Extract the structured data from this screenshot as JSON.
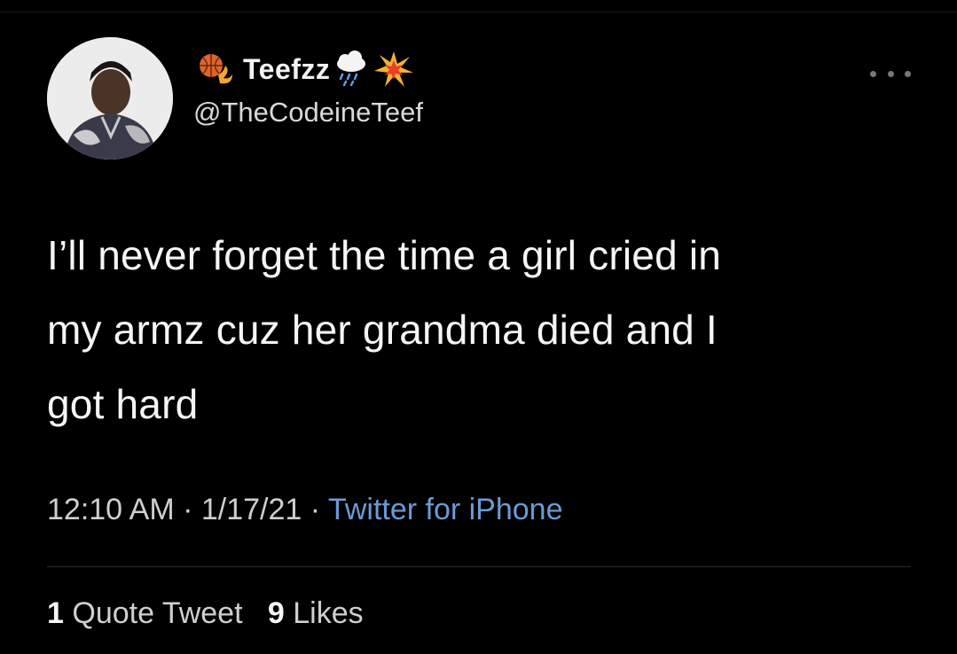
{
  "author": {
    "display_name": "Teefzz",
    "handle": "@TheCodeineTeef",
    "avatar_icon": "profile-photo",
    "emojis_before": [
      "basketball-fire-emoji"
    ],
    "emojis_after": [
      "cloud-rain-emoji",
      "collision-emoji"
    ]
  },
  "tweet": {
    "lines": [
      "I’ll never forget the time a girl cried in",
      "my armz cuz her grandma died and I",
      "got hard"
    ]
  },
  "meta": {
    "time": "12:10 AM",
    "sep1": " · ",
    "date": "1/17/21",
    "sep2": " · ",
    "source": "Twitter for iPhone"
  },
  "stats": {
    "quote_count": "1",
    "quote_label": "Quote Tweet",
    "like_count": "9",
    "like_label": "Likes"
  },
  "colors": {
    "background": "#000000",
    "text": "#f5f5f5",
    "link": "#6b9ad6"
  }
}
